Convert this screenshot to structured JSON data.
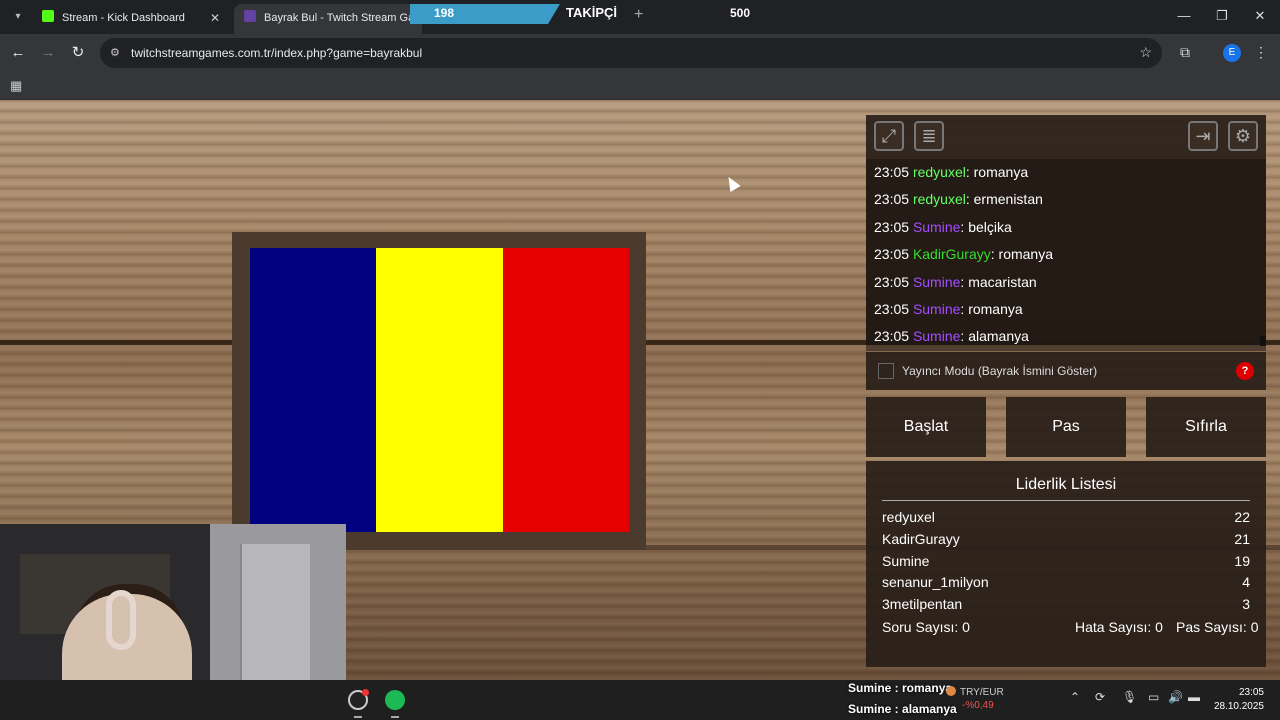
{
  "browser": {
    "tabs": [
      {
        "title": "Stream - Kick Dashboard",
        "active": false
      },
      {
        "title": "Bayrak Bul - Twitch Stream Gam",
        "active": true
      }
    ],
    "url": "twitchstreamgames.com.tr/index.php?game=bayrakbul",
    "profile_initial": "E"
  },
  "follower_overlay": {
    "current": "198",
    "label": "TAKİPÇİ",
    "goal": "500"
  },
  "flag": {
    "colors": [
      "#000080",
      "#ffff00",
      "#e60000"
    ]
  },
  "chat": [
    {
      "time": "23:05",
      "user": "redyuxel",
      "user_color": "#66ff66",
      "message": "romanya"
    },
    {
      "time": "23:05",
      "user": "redyuxel",
      "user_color": "#66ff66",
      "message": "ermenistan"
    },
    {
      "time": "23:05",
      "user": "Sumine",
      "user_color": "#a34dff",
      "message": "belçika"
    },
    {
      "time": "23:05",
      "user": "KadirGurayy",
      "user_color": "#33dd33",
      "message": "romanya"
    },
    {
      "time": "23:05",
      "user": "Sumine",
      "user_color": "#a34dff",
      "message": "macaristan"
    },
    {
      "time": "23:05",
      "user": "Sumine",
      "user_color": "#a34dff",
      "message": "romanya"
    },
    {
      "time": "23:05",
      "user": "Sumine",
      "user_color": "#a34dff",
      "message": "alamanya"
    }
  ],
  "streamer_mode": {
    "label": "Yayıncı Modu (Bayrak İsmini Göster)",
    "checked": false,
    "help": "?"
  },
  "buttons": {
    "start": "Başlat",
    "pass": "Pas",
    "reset": "Sıfırla"
  },
  "leaderboard": {
    "title": "Liderlik Listesi",
    "rows": [
      {
        "name": "redyuxel",
        "score": "22"
      },
      {
        "name": "KadirGurayy",
        "score": "21"
      },
      {
        "name": "Sumine",
        "score": "19"
      },
      {
        "name": "senanur_1milyon",
        "score": "4"
      },
      {
        "name": "3metilpentan",
        "score": "3"
      }
    ],
    "question_count": "Soru Sayısı: 0",
    "error_count": "Hata Sayısı: 0",
    "pass_count": "Pas Sayısı: 0"
  },
  "chat_overlay": [
    {
      "user": "Sumine",
      "message": "romanya"
    },
    {
      "user": "Sumine",
      "message": "alamanya"
    }
  ],
  "taskbar": {
    "fx_pair": "TRY/EUR",
    "fx_change": "-%0,49",
    "time": "23:05",
    "date": "28.10.2025"
  }
}
